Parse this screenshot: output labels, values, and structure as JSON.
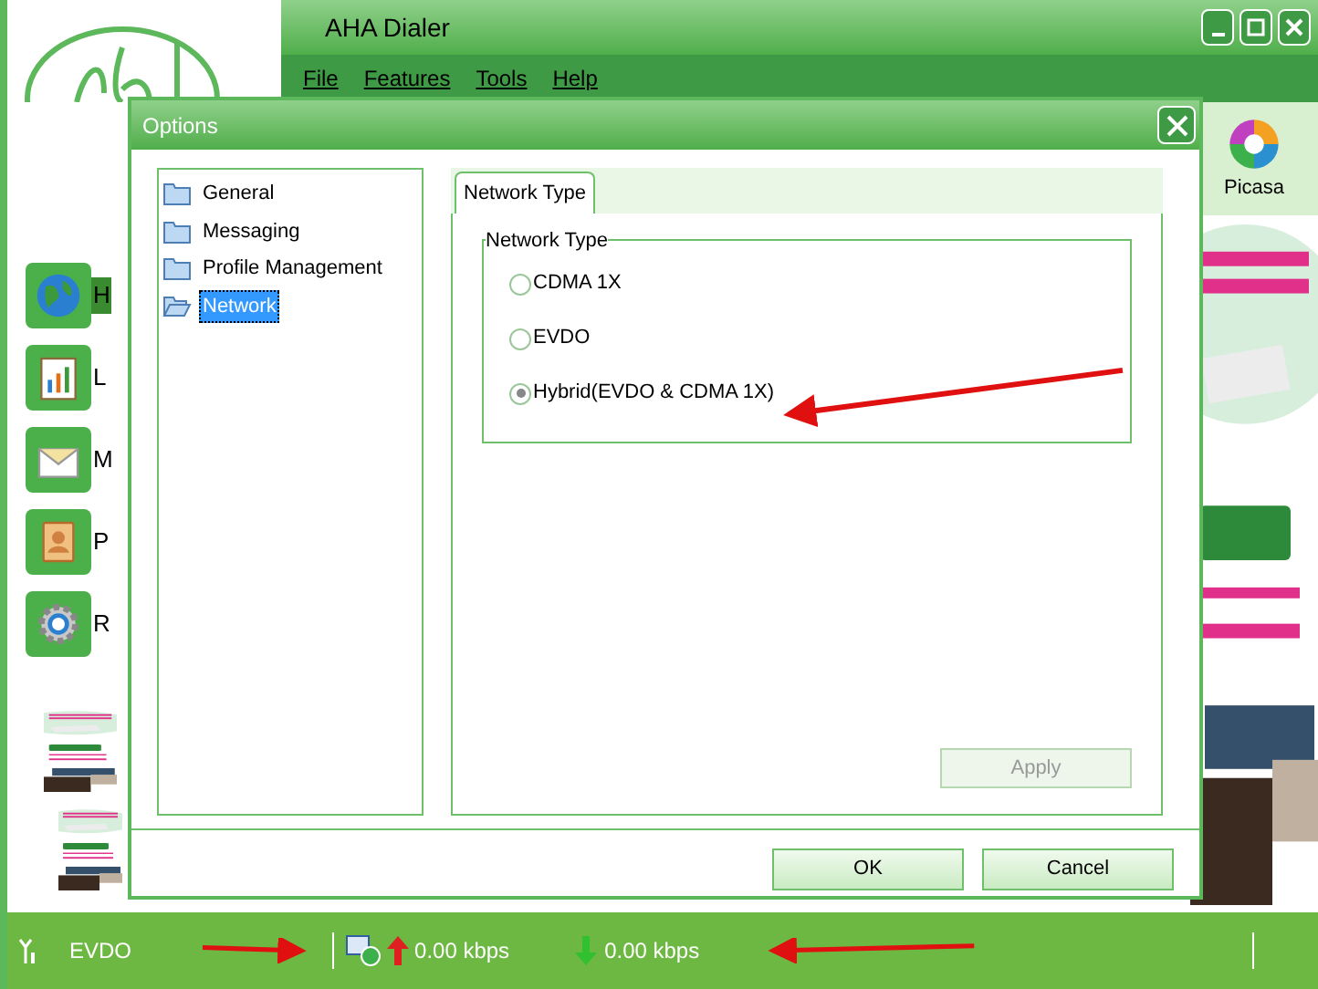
{
  "window": {
    "title": "AHA Dialer"
  },
  "menu": [
    "File",
    "Features",
    "Tools",
    "Help"
  ],
  "sidebar": {
    "items": [
      {
        "label": "H",
        "kind": "globe",
        "selected": true
      },
      {
        "label": "L",
        "kind": "chart",
        "selected": false
      },
      {
        "label": "M",
        "kind": "mail",
        "selected": false
      },
      {
        "label": "P",
        "kind": "contacts",
        "selected": false
      },
      {
        "label": "R",
        "kind": "settings",
        "selected": false
      }
    ]
  },
  "shortcut": {
    "label": "Picasa"
  },
  "dialog": {
    "title": "Options",
    "tree": [
      {
        "label": "General",
        "selected": false
      },
      {
        "label": "Messaging",
        "selected": false
      },
      {
        "label": "Profile Management",
        "selected": false
      },
      {
        "label": "Network",
        "selected": true
      }
    ],
    "tabs": [
      {
        "label": "Network Type",
        "selected": true
      }
    ],
    "group": {
      "legend": "Network Type",
      "options": [
        {
          "label": "CDMA 1X",
          "selected": false
        },
        {
          "label": "EVDO",
          "selected": false
        },
        {
          "label": "Hybrid(EVDO & CDMA 1X)",
          "selected": true
        }
      ]
    },
    "apply": {
      "label": "Apply",
      "disabled": true
    },
    "buttons": [
      "OK",
      "Cancel"
    ]
  },
  "status_bar": {
    "network": "EVDO",
    "upload": "0.00 kbps",
    "download": "0.00 kbps"
  }
}
